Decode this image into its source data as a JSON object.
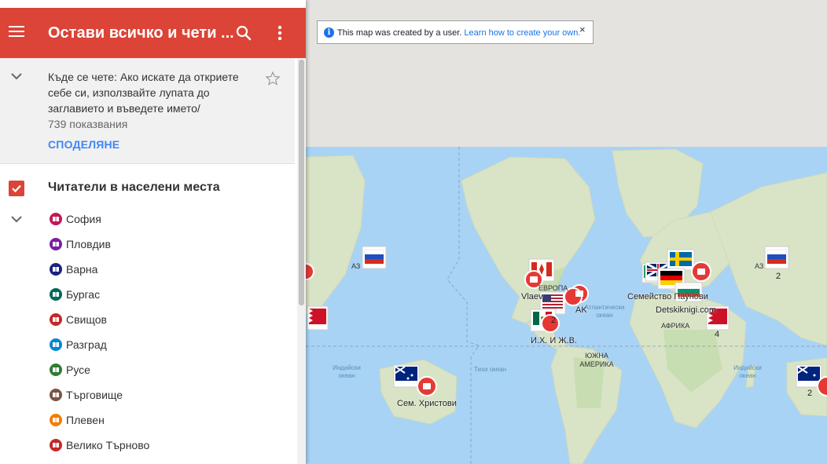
{
  "header": {
    "title": "Остави всичко и чети ...",
    "menu_icon": "hamburger-menu-icon",
    "search_icon": "search-icon",
    "more_icon": "more-vert-icon"
  },
  "info_panel": {
    "description": "Къде се чете: Ако искате да откриете себе си, използвайте лупата до заглавието и въведете името/",
    "views": "739 показвания",
    "share_label": "СПОДЕЛЯНЕ"
  },
  "layer": {
    "name": "Читатели в населени места",
    "checked": true,
    "items": [
      {
        "label": "София",
        "color": "#c2185b"
      },
      {
        "label": "Пловдив",
        "color": "#7b1fa2"
      },
      {
        "label": "Варна",
        "color": "#1a237e"
      },
      {
        "label": "Бургас",
        "color": "#00695c"
      },
      {
        "label": "Свищов",
        "color": "#c62828"
      },
      {
        "label": "Разград",
        "color": "#0288d1"
      },
      {
        "label": "Русе",
        "color": "#2e7d32"
      },
      {
        "label": "Търговище",
        "color": "#795548"
      },
      {
        "label": "Плевен",
        "color": "#f57c00"
      },
      {
        "label": "Велико Търново",
        "color": "#c62828"
      }
    ]
  },
  "notice": {
    "text": "This map was created by a user.",
    "link": "Learn how to create your own.",
    "close": "×"
  },
  "map": {
    "ocean_labels": [
      "Атлантически океан",
      "Индийски океан",
      "Тихи океан",
      "Индийски океан"
    ],
    "continent_labels": [
      "ЕВРОПА",
      "ЮЖНА АМЕРИКА",
      "АФРИКА",
      "АЗ",
      "АЗ"
    ],
    "marker_labels": [
      "Vlaev",
      "AK",
      "И.Х. И Ж.В.",
      "Семейство Паунови",
      "Detskiknigi.com",
      "Сем. Христови"
    ],
    "cluster_counts": [
      "2",
      "2",
      "4",
      "2"
    ]
  }
}
